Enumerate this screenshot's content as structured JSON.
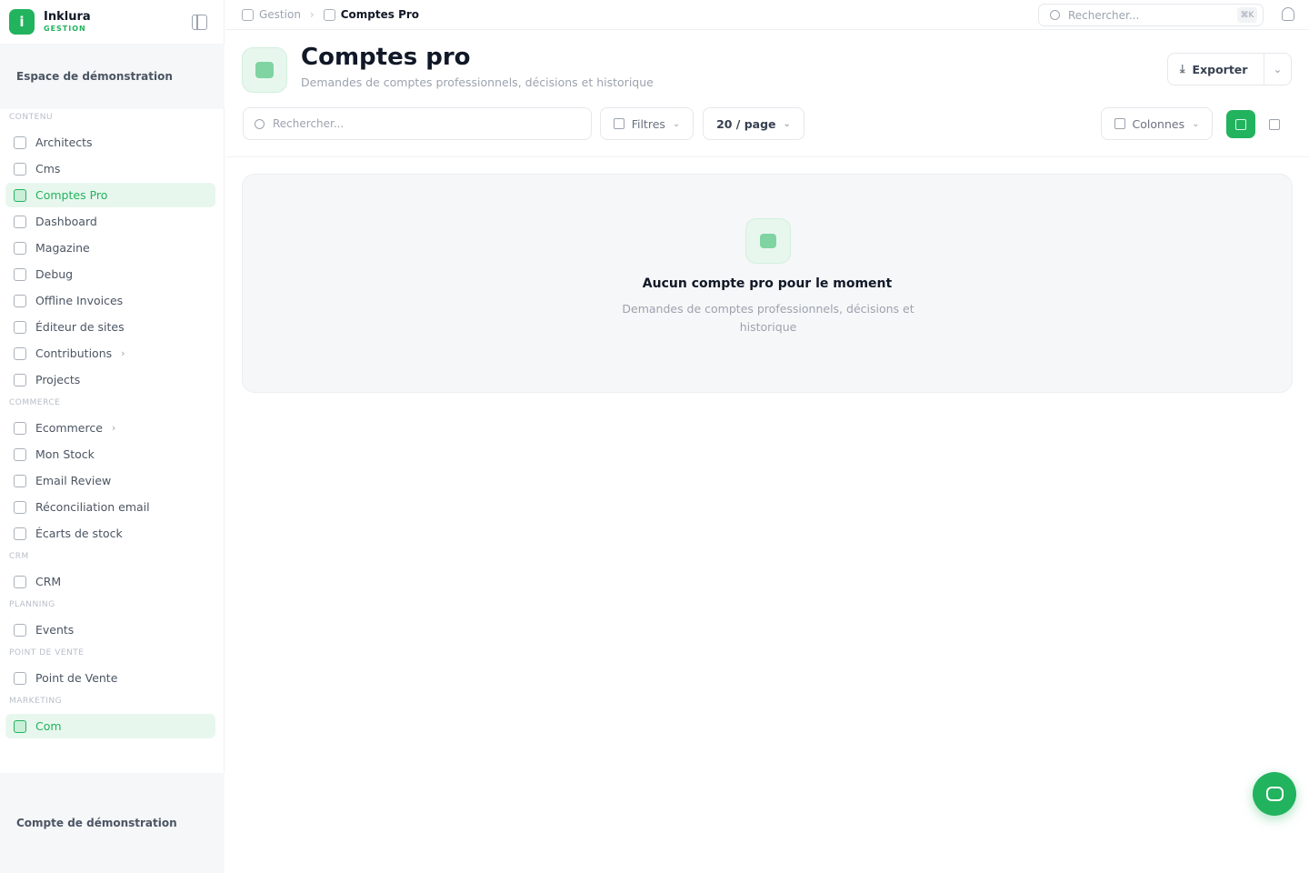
{
  "brand": {
    "name": "Inklura",
    "sub": "GESTION"
  },
  "sidebar": {
    "workspace": "Espace de démonstration",
    "groups": [
      {
        "title": "Contenu",
        "items": [
          {
            "label": "Architects",
            "icon": "building-icon"
          },
          {
            "label": "Cms",
            "icon": "document-icon"
          },
          {
            "label": "Comptes Pro",
            "icon": "briefcase-icon",
            "active": true
          },
          {
            "label": "Dashboard",
            "icon": "dashboard-icon"
          },
          {
            "label": "Magazine",
            "icon": "magazine-icon"
          },
          {
            "label": "Debug",
            "icon": "bug-icon"
          },
          {
            "label": "Offline Invoices",
            "icon": "invoice-icon"
          },
          {
            "label": "Éditeur de sites",
            "icon": "terminal-icon"
          },
          {
            "label": "Contributions",
            "icon": "contributions-icon",
            "chevron": true
          },
          {
            "label": "Projects",
            "icon": "folder-icon"
          }
        ]
      },
      {
        "title": "Commerce",
        "items": [
          {
            "label": "Ecommerce",
            "icon": "cart-icon",
            "chevron": true
          },
          {
            "label": "Mon Stock",
            "icon": "cart-icon"
          },
          {
            "label": "Email Review",
            "icon": "cart-icon"
          },
          {
            "label": "Réconciliation email",
            "icon": "cart-icon"
          },
          {
            "label": "Écarts de stock",
            "icon": "cart-icon"
          }
        ]
      },
      {
        "title": "CRM",
        "items": [
          {
            "label": "CRM",
            "icon": "user-icon"
          }
        ]
      },
      {
        "title": "Planning",
        "items": [
          {
            "label": "Events",
            "icon": "calendar-icon"
          }
        ]
      },
      {
        "title": "Point de vente",
        "items": [
          {
            "label": "Point de Vente",
            "icon": "store-icon"
          }
        ]
      },
      {
        "title": "Marketing",
        "items": [
          {
            "label": "Com",
            "icon": "megaphone-icon",
            "active": true
          }
        ]
      }
    ],
    "account": "Compte de démonstration"
  },
  "topbar": {
    "breadcrumb_home": "Gestion",
    "breadcrumb_current": "Comptes Pro",
    "search_placeholder": "Rechercher...",
    "shortcut": "⌘K"
  },
  "header": {
    "title": "Comptes pro",
    "subtitle": "Demandes de comptes professionnels, décisions et historique",
    "export_label": "Exporter"
  },
  "toolbar": {
    "search_placeholder": "Rechercher...",
    "filters_label": "Filtres",
    "per_page_label": "20 / page",
    "columns_label": "Colonnes"
  },
  "empty_state": {
    "title": "Aucun compte pro pour le moment",
    "description": "Demandes de comptes professionnels, décisions et historique"
  },
  "colors": {
    "accent": "#22b35e",
    "accent_light": "#e8f7ee"
  }
}
